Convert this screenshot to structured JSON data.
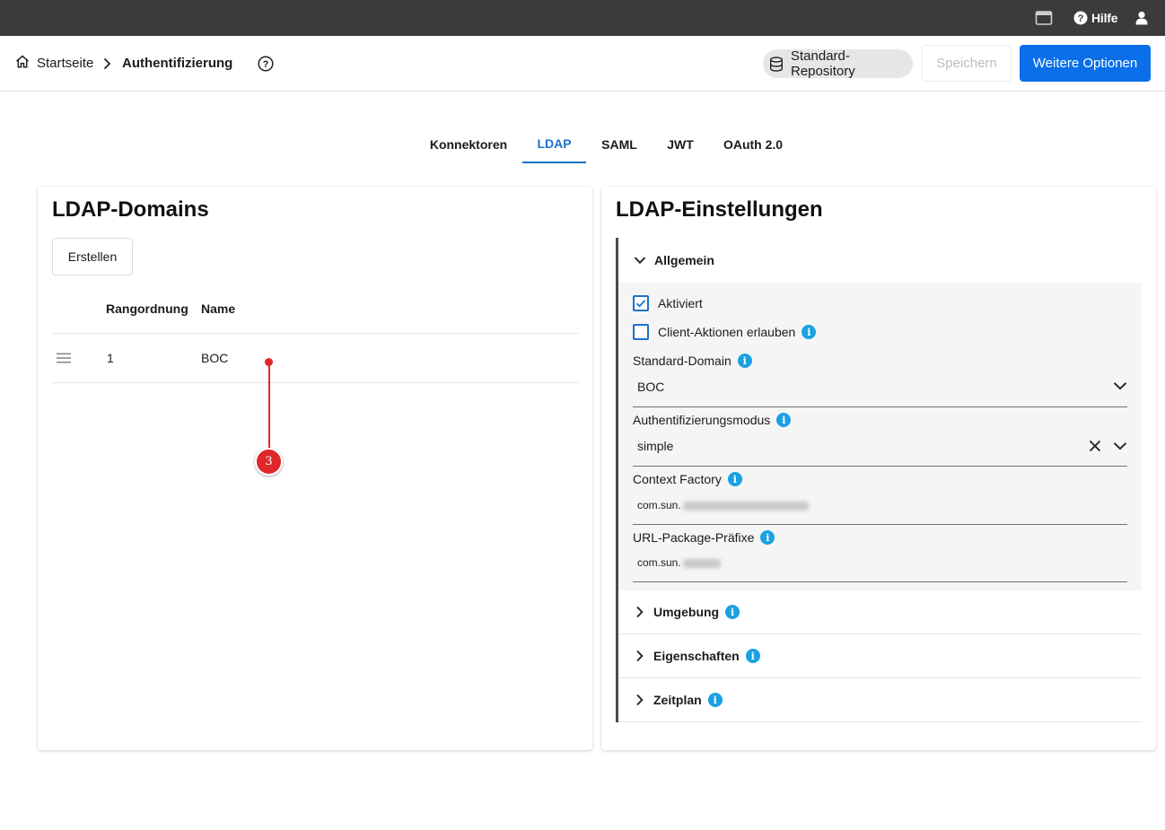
{
  "topbar": {
    "help_label": "Hilfe"
  },
  "breadcrumb": {
    "home": "Startseite",
    "current": "Authentifizierung"
  },
  "header": {
    "repository": "Standard-Repository",
    "save": "Speichern",
    "more_options": "Weitere Optionen"
  },
  "tabs": [
    {
      "label": "Konnektoren",
      "active": false
    },
    {
      "label": "LDAP",
      "active": true
    },
    {
      "label": "SAML",
      "active": false
    },
    {
      "label": "JWT",
      "active": false
    },
    {
      "label": "OAuth 2.0",
      "active": false
    }
  ],
  "domains": {
    "title": "LDAP-Domains",
    "create": "Erstellen",
    "columns": [
      "Rangordnung",
      "Name"
    ],
    "rows": [
      {
        "rank": "1",
        "name": "BOC"
      }
    ]
  },
  "annotation": {
    "number": "3"
  },
  "settings": {
    "title": "LDAP-Einstellungen",
    "general": {
      "title": "Allgemein",
      "enabled": {
        "label": "Aktiviert",
        "checked": true
      },
      "client_actions": {
        "label": "Client-Aktionen erlauben",
        "checked": false
      },
      "default_domain": {
        "label": "Standard-Domain",
        "value": "BOC"
      },
      "auth_mode": {
        "label": "Authentifizierungsmodus",
        "value": "simple"
      },
      "context_factory": {
        "label": "Context Factory",
        "value": "com.sun."
      },
      "url_prefix": {
        "label": "URL-Package-Präfixe",
        "value": "com.sun."
      }
    },
    "environment": "Umgebung",
    "properties": "Eigenschaften",
    "schedule": "Zeitplan"
  },
  "colors": {
    "accent": "#0a6fe8",
    "tab_active": "#1a73c8",
    "info": "#1ba1e2",
    "annotation": "#e0272a",
    "topbar": "#3b3b3b"
  }
}
